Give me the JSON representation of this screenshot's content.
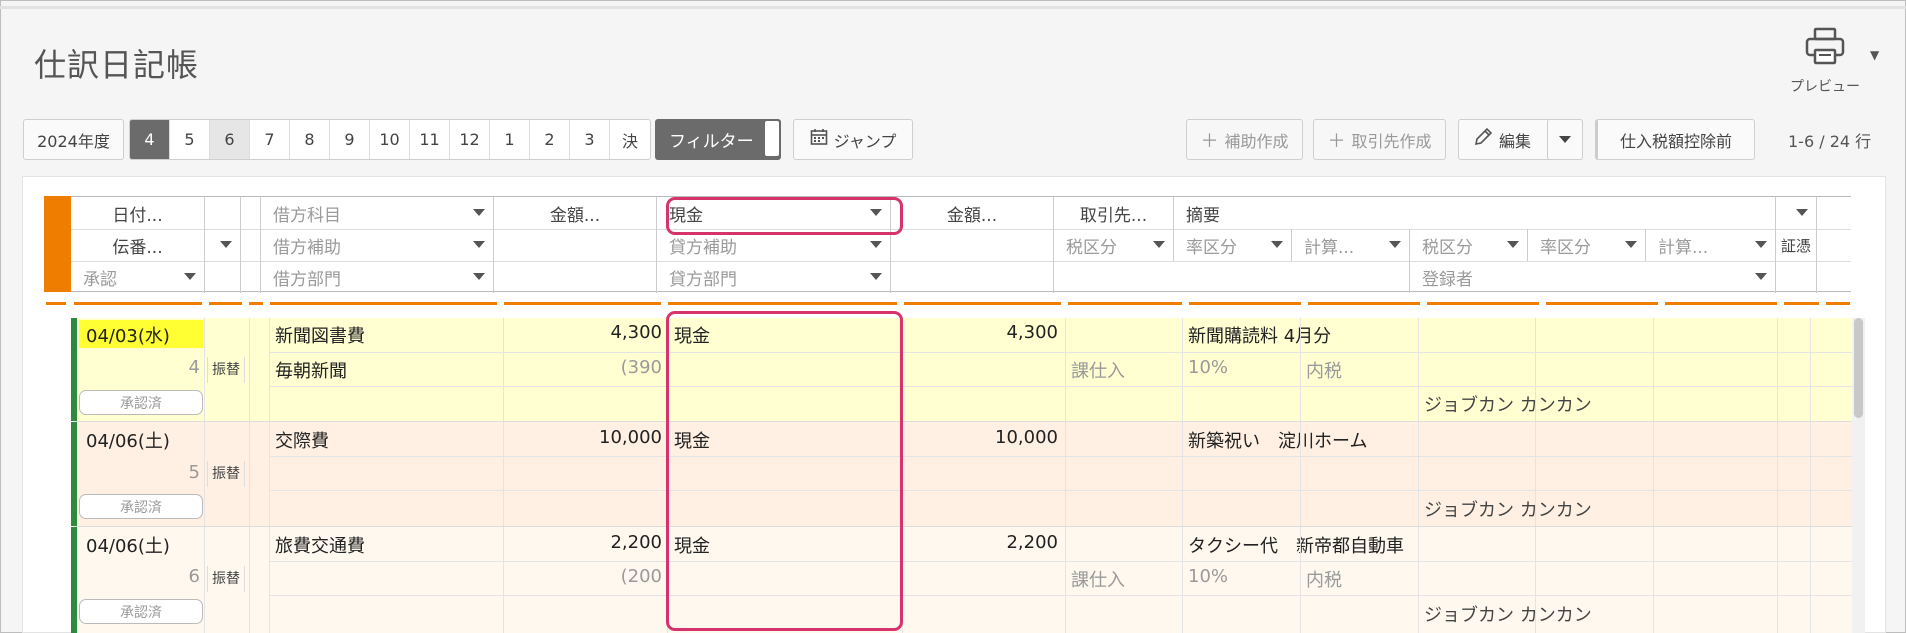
{
  "page": {
    "title": "仕訳日記帳"
  },
  "preview": {
    "label": "プレビュー",
    "icon": "printer-icon"
  },
  "toolbar": {
    "year": "2024年度",
    "months": [
      "4",
      "5",
      "6",
      "7",
      "8",
      "9",
      "10",
      "11",
      "12",
      "1",
      "2",
      "3",
      "決"
    ],
    "filter_label": "フィルター",
    "jump_label": "ジャンプ",
    "add_aux_label": "補助作成",
    "add_partner_label": "取引先作成",
    "edit_label": "編集",
    "tax_mode_label": "仕入税額控除前",
    "count_text": "1-6 / 24 行"
  },
  "headers": {
    "date": "日付...",
    "slip_no": "伝番...",
    "approval": "承認",
    "debit_account": "借方科目",
    "debit_sub": "借方補助",
    "debit_dept": "借方部門",
    "amount1": "金額...",
    "credit_account": "現金",
    "credit_sub": "貸方補助",
    "credit_dept": "貸方部門",
    "amount2": "金額...",
    "partner": "取引先...",
    "memo": "摘要",
    "tax1": "税区分",
    "rate1": "率区分",
    "calc1": "計算...",
    "tax2": "税区分",
    "rate2": "率区分",
    "calc2": "計算...",
    "voucher": "証憑",
    "registrant": "登録者"
  },
  "rows": [
    {
      "date": "04/03(水)",
      "no": "4",
      "type": "振替",
      "status": "承認済",
      "debit": "新聞図書費",
      "debit_sub": "毎朝新聞",
      "amount": "4,300",
      "tax_amount": "(390",
      "credit": "現金",
      "credit_amount": "4,300",
      "memo": "新聞購読料 4月分",
      "tax": "課仕入",
      "rate": "10%",
      "calc": "内税",
      "registrant": "ジョブカン カンカン"
    },
    {
      "date": "04/06(土)",
      "no": "5",
      "type": "振替",
      "status": "承認済",
      "debit": "交際費",
      "debit_sub": "",
      "amount": "10,000",
      "tax_amount": "",
      "credit": "現金",
      "credit_amount": "10,000",
      "memo": "新築祝い　淀川ホーム",
      "tax": "",
      "rate": "",
      "calc": "",
      "registrant": "ジョブカン カンカン"
    },
    {
      "date": "04/06(土)",
      "no": "6",
      "type": "振替",
      "status": "承認済",
      "debit": "旅費交通費",
      "debit_sub": "",
      "amount": "2,200",
      "tax_amount": "(200",
      "credit": "現金",
      "credit_amount": "2,200",
      "memo": "タクシー代　新帝都自動車",
      "tax": "課仕入",
      "rate": "10%",
      "calc": "内税",
      "registrant": "ジョブカン カンカン"
    }
  ],
  "colors": {
    "accent_orange": "#ef7d00",
    "highlight_pink": "#d6336c",
    "row_yellow": "#ffffd2",
    "row_peach": "#fff0e3",
    "row_cream": "#fff8ef",
    "date_yellow": "#ffff33",
    "approved_green": "#2e8b3e"
  }
}
